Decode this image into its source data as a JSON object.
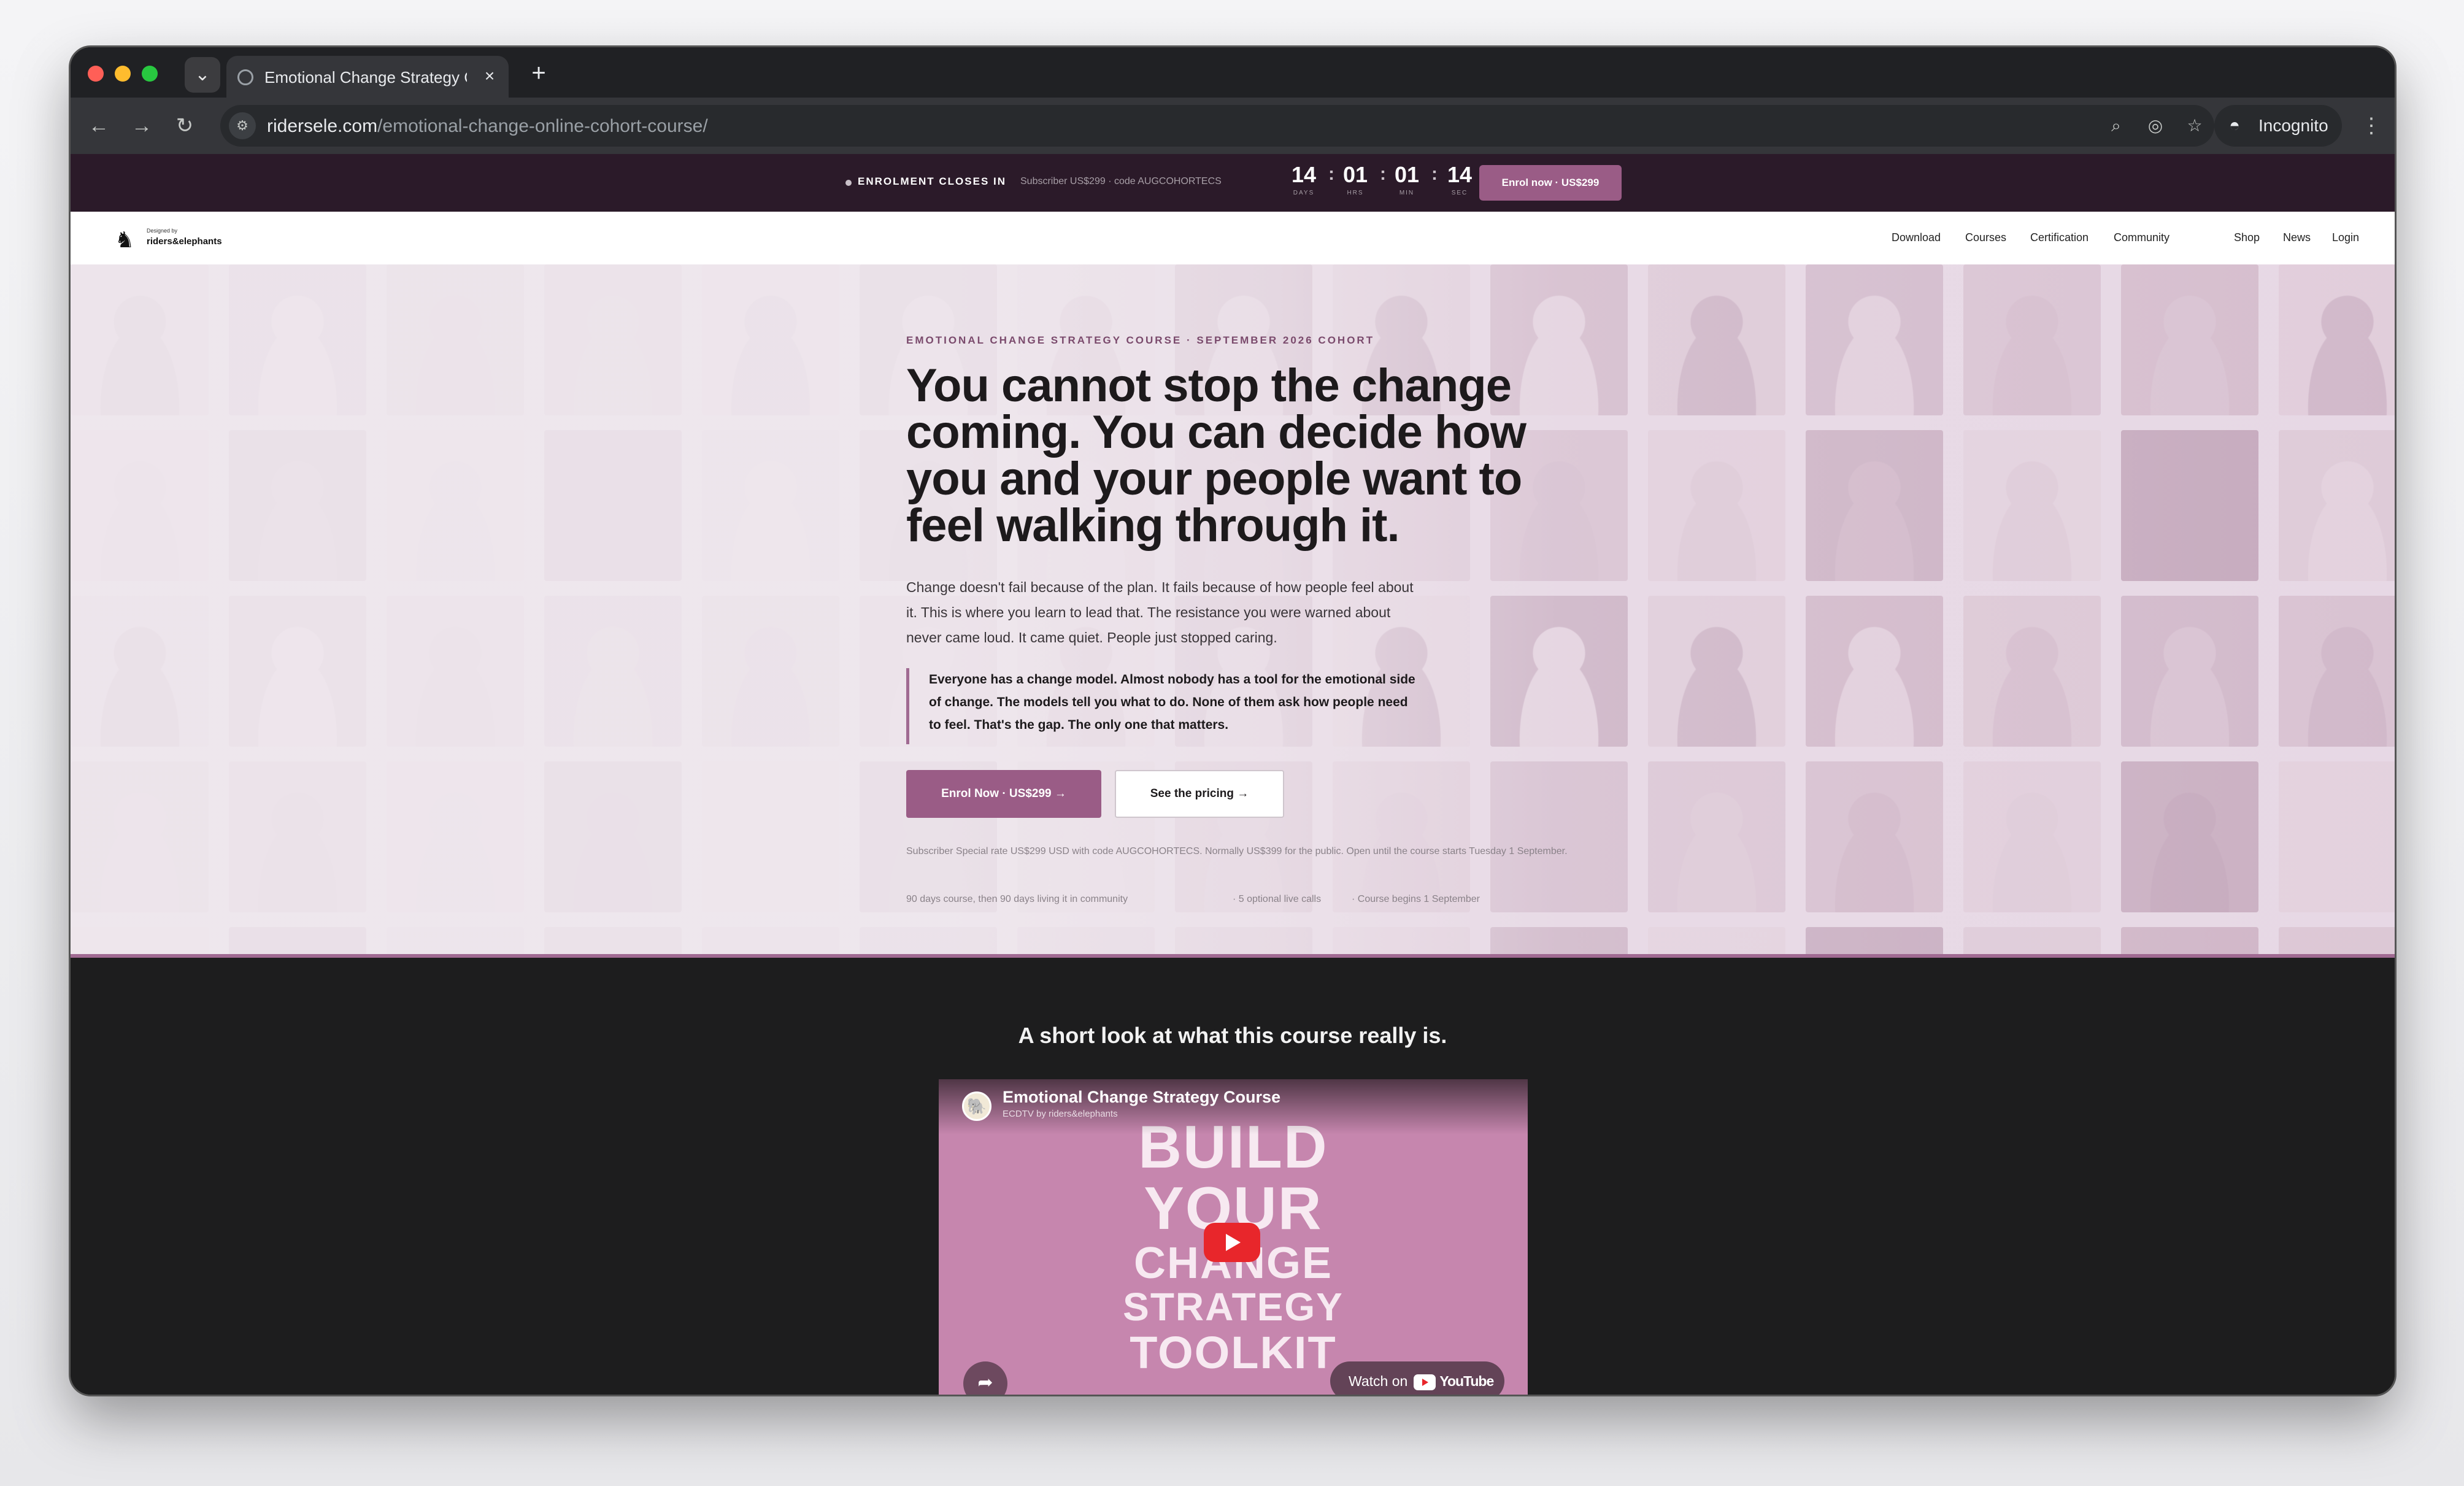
{
  "browser": {
    "tab_title": "Emotional Change Strategy Course",
    "url_domain": "ridersele.com",
    "url_path": "/emotional-change-online-cohort-course/",
    "incognito_label": "Incognito",
    "traffic_colors": [
      "#ff5f57",
      "#febc2e",
      "#28c840"
    ]
  },
  "promo": {
    "closes_label": "ENROLMENT CLOSES IN",
    "subscriber_text": "Subscriber US$299 · code AUGCOHORTECS",
    "countdown": [
      {
        "value": "14",
        "label": "DAYS"
      },
      {
        "value": "01",
        "label": "HRS"
      },
      {
        "value": "01",
        "label": "MIN"
      },
      {
        "value": "14",
        "label": "SEC"
      }
    ],
    "button": "Enrol now · US$299"
  },
  "nav": {
    "logo_small": "Designed by",
    "logo_text": "riders&elephants",
    "links": [
      "Download",
      "Courses",
      "Certification",
      "Community",
      "Shop",
      "News",
      "Login"
    ]
  },
  "hero": {
    "eyebrow": "EMOTIONAL CHANGE STRATEGY COURSE · SEPTEMBER 2026 COHORT",
    "headline": "You cannot stop the change coming. You can decide how you and your people want to feel walking through it.",
    "lede": "Change doesn't fail because of the plan. It fails because of how people feel about it. This is where you learn to lead that. The resistance you were warned about never came loud. It came quiet. People just stopped caring.",
    "quote": "Everyone has a change model. Almost nobody has a tool for the emotional side of change. The models tell you what to do. None of them ask how people need to feel. That's the gap. The only one that matters.",
    "primary_cta": "Enrol Now · US$299 →",
    "secondary_cta": "See the pricing →",
    "fine_print": "Subscriber Special rate US$299 USD with code AUGCOHORTECS. Normally US$399 for the public. Open until the course starts Tuesday 1 September.",
    "meta": [
      "90 days course, then 90 days living it in community",
      "· 5 optional live calls",
      "· Course begins 1 September"
    ],
    "accent_color": "#9a5c86"
  },
  "video": {
    "section_title": "A short look at what this course really is.",
    "player_title": "Emotional Change Strategy Course",
    "channel": "ECDTV by riders&elephants",
    "thumb_lines": [
      "BUILD",
      "YOUR",
      "CHANGE",
      "STRATEGY",
      "TOOLKIT"
    ],
    "watch_on": "Watch on",
    "youtube": "YouTube"
  }
}
